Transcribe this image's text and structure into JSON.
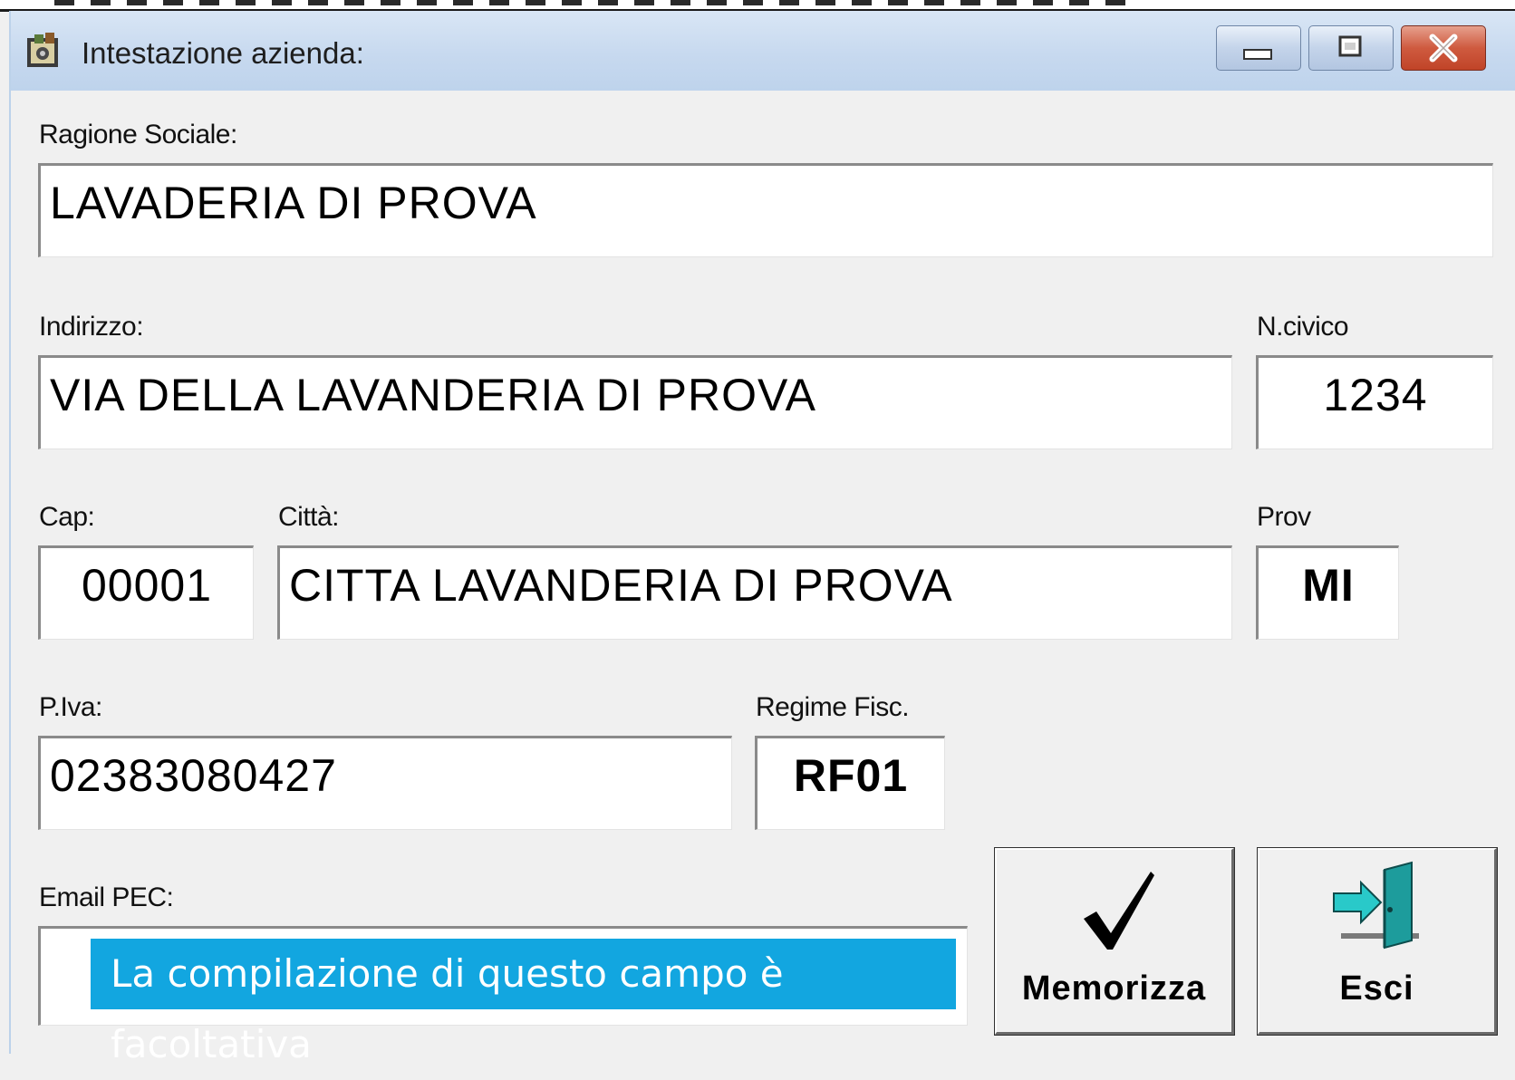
{
  "window": {
    "title": "Intestazione azienda:"
  },
  "form": {
    "ragione_sociale": {
      "label": "Ragione Sociale:",
      "value": "LAVADERIA DI PROVA"
    },
    "indirizzo": {
      "label": "Indirizzo:",
      "value": "VIA DELLA LAVANDERIA DI PROVA"
    },
    "n_civico": {
      "label": "N.civico",
      "value": "1234"
    },
    "cap": {
      "label": "Cap:",
      "value": "00001"
    },
    "citta": {
      "label": "Città:",
      "value": "CITTA LAVANDERIA DI PROVA"
    },
    "prov": {
      "label": "Prov",
      "value": "MI"
    },
    "piva": {
      "label": "P.Iva:",
      "value": "02383080427"
    },
    "regime_fisc": {
      "label": "Regime Fisc.",
      "value": "RF01"
    },
    "email_pec": {
      "label": "Email PEC:",
      "value": ""
    }
  },
  "buttons": {
    "memorizza": "Memorizza",
    "esci": "Esci"
  },
  "tooltip": "La compilazione di questo campo è facoltativa",
  "colors": {
    "tooltip_bg": "#12a6e0",
    "titlebar": "#c7d9ef",
    "close_button": "#cf5a3f"
  },
  "icons": [
    "app-icon",
    "minimize-icon",
    "maximize-icon",
    "close-icon",
    "checkmark-icon",
    "exit-door-icon"
  ]
}
